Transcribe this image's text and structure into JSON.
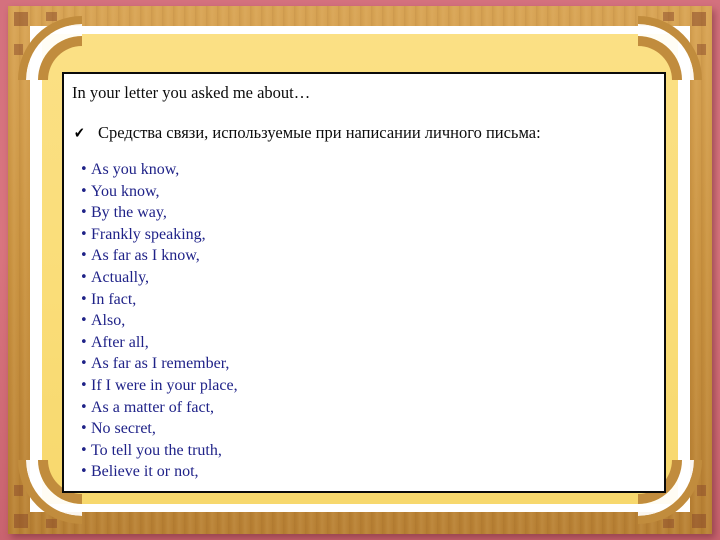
{
  "slide": {
    "colors": {
      "outer_background": "#d9737f",
      "wood_frame": "#c8913f",
      "white_mat": "#ffffff",
      "yellow_mat": "#fbdf7e",
      "content_background": "#ffffff",
      "content_border": "#0a0a0a",
      "heading_text": "#0c0c0c",
      "list_text": "#1f2288"
    }
  },
  "content": {
    "lead_line": "In your letter you asked me about…",
    "check_icon": "✔",
    "check_heading": "Средства связи, используемые при написании личного письма:",
    "bullet_glyph": "•",
    "phrases": [
      "As you know,",
      "You know,",
      "By the way,",
      "Frankly speaking,",
      "As far as I know,",
      "Actually,",
      "In fact,",
      "Also,",
      "After all,",
      "As far as I remember,",
      "If I were in your place,",
      "As a matter of fact,",
      "No secret,",
      "To tell you the truth,",
      "Believe it or not,"
    ]
  }
}
